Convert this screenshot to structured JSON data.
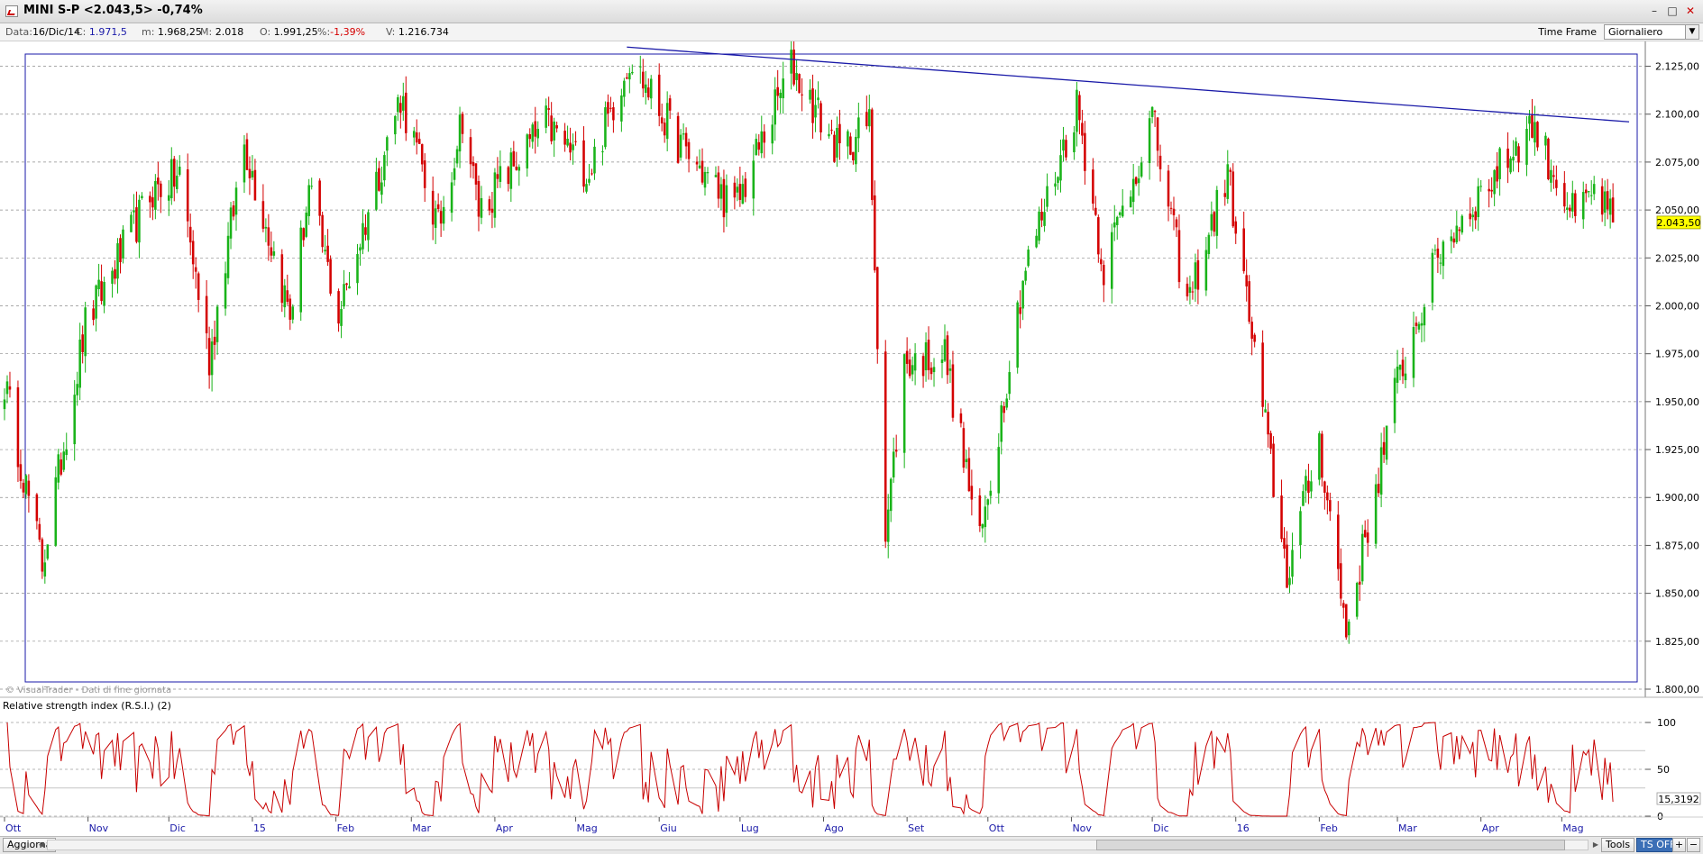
{
  "window": {
    "title": "MINI S-P <2.043,5> -0,74%",
    "controls": [
      "–",
      "□",
      "✕"
    ]
  },
  "infobar": {
    "date_label": "Data:",
    "date_value": "16/Dic/14",
    "close_label": "C:",
    "close_value": "1.971,5",
    "min_label": "m:",
    "min_value": "1.968,25",
    "max_label": "M:",
    "max_value": "2.018",
    "open_label": "O:",
    "open_value": "1.991,25",
    "pct_label": "%:",
    "pct_value": "-1,39%",
    "vol_label": "V:",
    "vol_value": "1.216.734",
    "timeframe_label": "Time Frame",
    "timeframe_value": "Giornaliero"
  },
  "price_panel": {
    "y_ticks": [
      "1.800,00",
      "1.825,00",
      "1.850,00",
      "1.875,00",
      "1.900,00",
      "1.925,00",
      "1.950,00",
      "1.975,00",
      "2.000,00",
      "2.025,00",
      "2.050,00",
      "2.075,00",
      "2.100,00",
      "2.125,00"
    ],
    "last_price_label": "2.043,50",
    "watermark": "© VisualTrader - Dati di fine giornata"
  },
  "rsi_panel": {
    "title": "Relative strength index (R.S.I.) (2)",
    "y_ticks": [
      "100",
      "50",
      "0"
    ],
    "last_value_label": "15,3192"
  },
  "x_axis_labels": [
    "Ott",
    "Nov",
    "Dic",
    "15",
    "Feb",
    "Mar",
    "Apr",
    "Mag",
    "Giu",
    "Lug",
    "Ago",
    "Set",
    "Ott",
    "Nov",
    "Dic",
    "16",
    "Feb",
    "Mar",
    "Apr",
    "Mag"
  ],
  "bottombar": {
    "refresh_label": "Aggiorna",
    "tools_label": "Tools",
    "tsoff_label": "TS OFF",
    "plus_label": "+",
    "minus_label": "−"
  },
  "chart_data": [
    {
      "type": "candlestick",
      "title": "MINI S-P",
      "ylim": [
        1800,
        2137
      ],
      "x_start": "2014-10-01",
      "x_end": "2016-05-31",
      "colors": {
        "up": "#19b319",
        "down": "#d40000",
        "trendline": "#1a1aa8",
        "grid": "#8c8c8c"
      },
      "anchors": [
        {
          "date": "2014-10-01",
          "close": 1960
        },
        {
          "date": "2014-10-15",
          "close": 1865
        },
        {
          "date": "2014-10-31",
          "close": 1990
        },
        {
          "date": "2014-11-25",
          "close": 2060
        },
        {
          "date": "2014-12-05",
          "close": 2068
        },
        {
          "date": "2014-12-16",
          "close": 1972
        },
        {
          "date": "2014-12-29",
          "close": 2085
        },
        {
          "date": "2015-01-15",
          "close": 1995
        },
        {
          "date": "2015-01-22",
          "close": 2060
        },
        {
          "date": "2015-02-02",
          "close": 1995
        },
        {
          "date": "2015-02-25",
          "close": 2110
        },
        {
          "date": "2015-03-11",
          "close": 2040
        },
        {
          "date": "2015-03-20",
          "close": 2100
        },
        {
          "date": "2015-03-26",
          "close": 2050
        },
        {
          "date": "2015-04-20",
          "close": 2095
        },
        {
          "date": "2015-05-06",
          "close": 2070
        },
        {
          "date": "2015-05-21",
          "close": 2130
        },
        {
          "date": "2015-06-08",
          "close": 2085
        },
        {
          "date": "2015-06-29",
          "close": 2050
        },
        {
          "date": "2015-07-20",
          "close": 2125
        },
        {
          "date": "2015-08-07",
          "close": 2080
        },
        {
          "date": "2015-08-18",
          "close": 2095
        },
        {
          "date": "2015-08-24",
          "close": 1880
        },
        {
          "date": "2015-08-31",
          "close": 1970
        },
        {
          "date": "2015-09-15",
          "close": 1975
        },
        {
          "date": "2015-09-28",
          "close": 1875
        },
        {
          "date": "2015-10-14",
          "close": 2015
        },
        {
          "date": "2015-11-03",
          "close": 2105
        },
        {
          "date": "2015-11-13",
          "close": 2020
        },
        {
          "date": "2015-12-01",
          "close": 2098
        },
        {
          "date": "2015-12-14",
          "close": 2000
        },
        {
          "date": "2015-12-29",
          "close": 2070
        },
        {
          "date": "2016-01-20",
          "close": 1860
        },
        {
          "date": "2016-02-01",
          "close": 1930
        },
        {
          "date": "2016-02-11",
          "close": 1830
        },
        {
          "date": "2016-03-01",
          "close": 1960
        },
        {
          "date": "2016-03-17",
          "close": 2030
        },
        {
          "date": "2016-04-20",
          "close": 2095
        },
        {
          "date": "2016-05-06",
          "close": 2045
        },
        {
          "date": "2016-05-13",
          "close": 2060
        },
        {
          "date": "2016-05-20",
          "close": 2043.5
        }
      ],
      "trendline": [
        {
          "date": "2015-05-20",
          "value": 2135
        },
        {
          "date": "2016-05-26",
          "value": 2096
        }
      ],
      "last_close": 2043.5
    },
    {
      "type": "line",
      "title": "Relative strength index (R.S.I.) (2)",
      "ylim": [
        0,
        100
      ],
      "x_start": "2014-10-01",
      "x_end": "2016-05-31",
      "color": "#c80000",
      "guide_levels": [
        0,
        30,
        50,
        70,
        100
      ],
      "last_value": 15.3192
    }
  ]
}
